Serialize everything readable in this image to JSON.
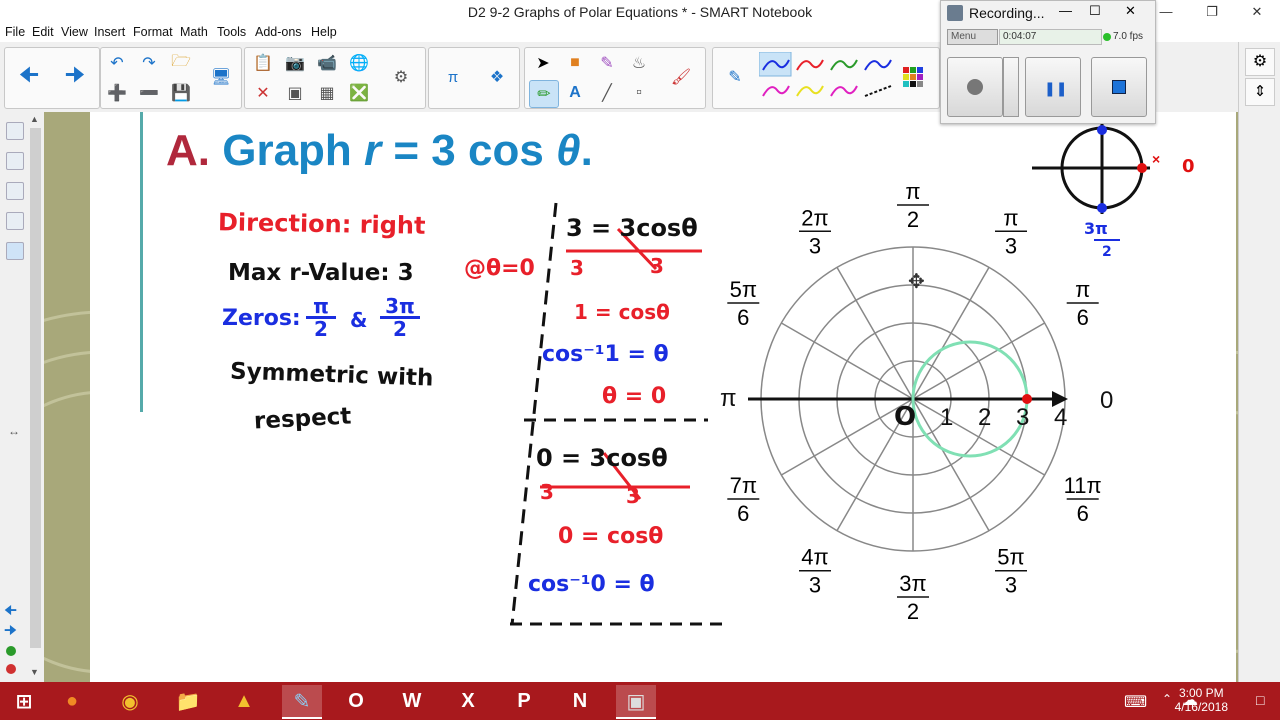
{
  "window": {
    "title": "D2 9-2 Graphs of Polar Equations * - SMART Notebook"
  },
  "menu": [
    "File",
    "Edit",
    "View",
    "Insert",
    "Format",
    "Math",
    "Tools",
    "Add-ons",
    "Help"
  ],
  "recorder": {
    "title": "Recording...",
    "menu_label": "Menu",
    "elapsed": "0:04:07",
    "fps": "7.0 fps"
  },
  "slide": {
    "heading_prefix": "A.",
    "heading_text": "Graph ",
    "heading_r": "r",
    "heading_eq": " = 3 cos ",
    "heading_theta": "θ",
    "heading_end": ".",
    "notes": {
      "direction": "Direction: right",
      "max_value": "Max r-Value: 3",
      "max_at": "@θ=0",
      "zeros_label": "Zeros:",
      "zeros_a_num": "π",
      "zeros_a_den": "2",
      "zeros_sep": "&",
      "zeros_b_num": "3π",
      "zeros_b_den": "2",
      "symmetric_1": "Symmetric with",
      "symmetric_2": "respect"
    },
    "work": {
      "eq1": "3 = 3cosθ",
      "eq1_den_l": "3",
      "eq1_den_r": "3",
      "eq2": "1 = cosθ",
      "eq3": "cos⁻¹1 = θ",
      "eq4": "θ = 0",
      "eq5": "0 = 3cosθ",
      "eq5_den_l": "3",
      "eq5_den_r": "3",
      "eq6": "0 = cosθ",
      "eq7": "cos⁻¹0 = θ"
    },
    "sketch": {
      "marker_label": "0",
      "bottom_num": "3π",
      "bottom_den": "2"
    },
    "polar": {
      "radial_labels": [
        "1",
        "2",
        "3",
        "4"
      ],
      "origin_label": "O",
      "angle_0": "0",
      "angle_pi": "π",
      "angle_labels": [
        {
          "num": "π",
          "den": "6"
        },
        {
          "num": "π",
          "den": "3"
        },
        {
          "num": "π",
          "den": "2"
        },
        {
          "num": "2π",
          "den": "3"
        },
        {
          "num": "5π",
          "den": "6"
        },
        {
          "num": "7π",
          "den": "6"
        },
        {
          "num": "4π",
          "den": "3"
        },
        {
          "num": "3π",
          "den": "2"
        },
        {
          "num": "5π",
          "den": "3"
        },
        {
          "num": "11π",
          "den": "6"
        }
      ],
      "curve_color": "#80e0b4",
      "point_color": "#e01010"
    }
  },
  "clock": {
    "time": "3:00 PM",
    "date": "4/16/2018"
  },
  "colors": {
    "heading_prefix": "#b0283c",
    "heading": "#1a86c4",
    "red_ink": "#e8202a",
    "blue_ink": "#1a2ee0",
    "black_ink": "#111111",
    "taskbar": "#a8191d"
  }
}
